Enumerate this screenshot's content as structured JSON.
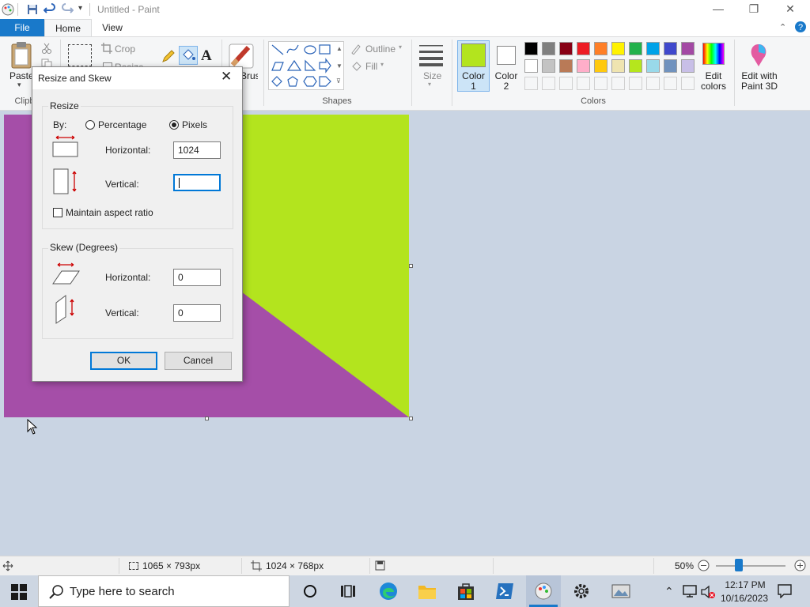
{
  "window": {
    "title": "Untitled - Paint",
    "minimize": "—",
    "restore": "❐",
    "close": "✕"
  },
  "tabs": {
    "file": "File",
    "home": "Home",
    "view": "View"
  },
  "ribbon": {
    "clipboard": {
      "paste": "Paste",
      "label": "Clipboard"
    },
    "image": {
      "crop": "Crop",
      "resize": "Resize"
    },
    "brushes": "Brushes",
    "shapes": {
      "outline": "Outline",
      "fill": "Fill",
      "label": "Shapes"
    },
    "size": "Size",
    "color1": {
      "line1": "Color",
      "line2": "1",
      "value": "#b3e41e"
    },
    "color2": {
      "line1": "Color",
      "line2": "2",
      "value": "#ffffff"
    },
    "colors_label": "Colors",
    "edit_colors": {
      "line1": "Edit",
      "line2": "colors"
    },
    "edit_3d": {
      "line1": "Edit with",
      "line2": "Paint 3D"
    },
    "palette_row1": [
      "#000000",
      "#7f7f7f",
      "#880015",
      "#ed1c24",
      "#ff7f27",
      "#fff200",
      "#22b14c",
      "#00a2e8",
      "#3f48cc",
      "#a349a4"
    ],
    "palette_row2": [
      "#ffffff",
      "#c3c3c3",
      "#b97a57",
      "#ffaec9",
      "#ffc90e",
      "#efe4b0",
      "#b5e61d",
      "#99d9ea",
      "#7092be",
      "#c8bfe7"
    ]
  },
  "canvas": {
    "purple": "#a54ea8",
    "green": "#b3e41e"
  },
  "dialog": {
    "title": "Resize and Skew",
    "resize_label": "Resize",
    "by_label": "By:",
    "percentage": "Percentage",
    "pixels": "Pixels",
    "horizontal_label": "Horizontal:",
    "horizontal_value": "1024",
    "vertical_label": "Vertical:",
    "vertical_value": "",
    "maintain_aspect": "Maintain aspect ratio",
    "skew_label": "Skew (Degrees)",
    "skew_horizontal_label": "Horizontal:",
    "skew_horizontal_value": "0",
    "skew_vertical_label": "Vertical:",
    "skew_vertical_value": "0",
    "ok": "OK",
    "cancel": "Cancel"
  },
  "statusbar": {
    "selection_size": "1065 × 793px",
    "image_size": "1024 × 768px",
    "zoom": "50%",
    "zoom_level": 0.5
  },
  "taskbar": {
    "search_placeholder": "Type here to search",
    "time": "12:17 PM",
    "date": "10/16/2023"
  }
}
